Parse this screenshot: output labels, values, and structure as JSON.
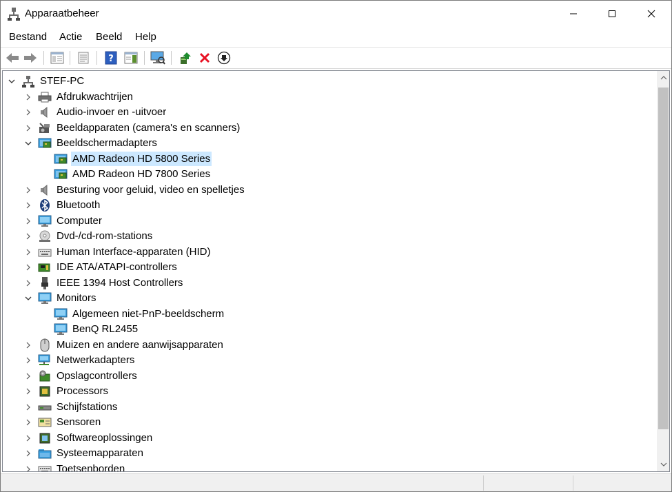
{
  "window": {
    "title": "Apparaatbeheer"
  },
  "menu": [
    "Bestand",
    "Actie",
    "Beeld",
    "Help"
  ],
  "toolbar": {
    "buttons": [
      "back-icon",
      "forward-icon",
      "properties-view-icon",
      "show-hidden-icon",
      "help-icon",
      "action-pane-icon",
      "scan-hardware-icon",
      "update-driver-icon",
      "uninstall-icon",
      "disable-device-icon"
    ]
  },
  "tree": {
    "root": "STEF-PC",
    "items": [
      {
        "label": "Afdrukwachtrijen",
        "expanded": false,
        "icon": "printer-icon"
      },
      {
        "label": "Audio-invoer en -uitvoer",
        "expanded": false,
        "icon": "speaker-icon"
      },
      {
        "label": "Beeldapparaten (camera's en scanners)",
        "expanded": false,
        "icon": "camera-icon"
      },
      {
        "label": "Beeldschermadapters",
        "expanded": true,
        "icon": "display-adapter-icon"
      },
      {
        "label": "AMD Radeon HD 5800 Series",
        "child": true,
        "selected": true,
        "icon": "display-adapter-icon"
      },
      {
        "label": "AMD Radeon HD 7800 Series",
        "child": true,
        "icon": "display-adapter-icon"
      },
      {
        "label": "Besturing voor geluid, video en spelletjes",
        "expanded": false,
        "icon": "speaker-icon"
      },
      {
        "label": "Bluetooth",
        "expanded": false,
        "icon": "bluetooth-icon"
      },
      {
        "label": "Computer",
        "expanded": false,
        "icon": "monitor-icon"
      },
      {
        "label": "Dvd-/cd-rom-stations",
        "expanded": false,
        "icon": "disc-drive-icon"
      },
      {
        "label": "Human Interface-apparaten (HID)",
        "expanded": false,
        "icon": "keyboard-icon"
      },
      {
        "label": "IDE ATA/ATAPI-controllers",
        "expanded": false,
        "icon": "controller-icon"
      },
      {
        "label": "IEEE 1394 Host Controllers",
        "expanded": false,
        "icon": "firewire-icon"
      },
      {
        "label": "Monitors",
        "expanded": true,
        "icon": "monitor-icon"
      },
      {
        "label": "Algemeen niet-PnP-beeldscherm",
        "child": true,
        "icon": "monitor-icon"
      },
      {
        "label": "BenQ RL2455",
        "child": true,
        "icon": "monitor-icon"
      },
      {
        "label": "Muizen en andere aanwijsapparaten",
        "expanded": false,
        "icon": "mouse-icon"
      },
      {
        "label": "Netwerkadapters",
        "expanded": false,
        "icon": "network-icon"
      },
      {
        "label": "Opslagcontrollers",
        "expanded": false,
        "icon": "storage-controller-icon"
      },
      {
        "label": "Processors",
        "expanded": false,
        "icon": "processor-icon"
      },
      {
        "label": "Schijfstations",
        "expanded": false,
        "icon": "disk-drive-icon"
      },
      {
        "label": "Sensoren",
        "expanded": false,
        "icon": "sensor-icon"
      },
      {
        "label": "Softwareoplossingen",
        "expanded": false,
        "icon": "software-icon"
      },
      {
        "label": "Systeemapparaten",
        "expanded": false,
        "icon": "system-folder-icon"
      },
      {
        "label": "Toetsenborden",
        "expanded": false,
        "icon": "keyboard-icon"
      }
    ]
  },
  "colors": {
    "selection": "#cce8ff",
    "scrollbar_thumb": "#c1c1c1",
    "uninstall_red": "#e81123",
    "help_blue": "#2d5fbf",
    "update_green": "#1e8c2e"
  }
}
